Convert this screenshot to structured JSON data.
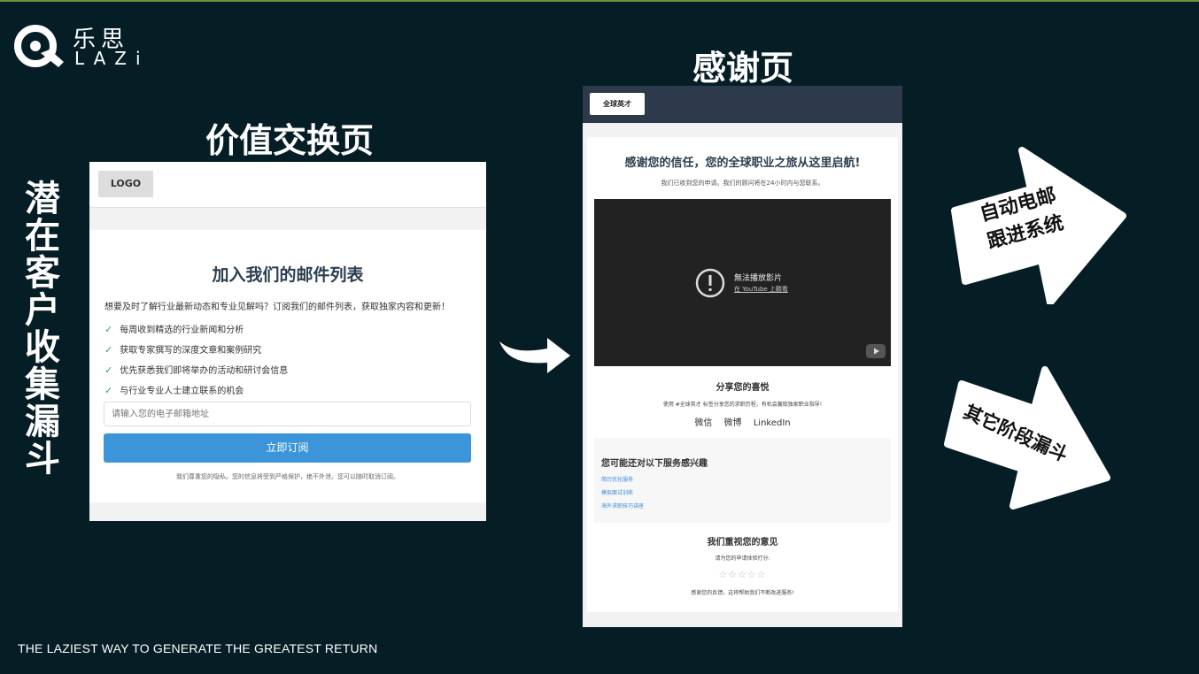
{
  "logo": {
    "cn": "乐思",
    "en": "LAZi"
  },
  "side_title": [
    "潜",
    "在",
    "客",
    "户",
    "收",
    "集",
    "漏",
    "斗"
  ],
  "value_page": {
    "section_title": "价值交换页",
    "logo_placeholder": "LOGO",
    "heading": "加入我们的邮件列表",
    "intro": "想要及时了解行业最新动态和专业见解吗？订阅我们的邮件列表，获取独家内容和更新！",
    "benefits": [
      "每周收到精选的行业新闻和分析",
      "获取专家撰写的深度文章和案例研究",
      "优先获悉我们即将举办的活动和研讨会信息",
      "与行业专业人士建立联系的机会"
    ],
    "email_placeholder": "请输入您的电子邮箱地址",
    "subscribe_label": "立即订阅",
    "privacy_note": "我们尊重您的隐私。您的信息将受到严格保护，绝不外泄。您可以随时取消订阅。"
  },
  "thank_you_page": {
    "section_title": "感谢页",
    "brand": "全球英才",
    "title": "感谢您的信任，您的全球职业之旅从这里启航!",
    "subtitle": "我们已收到您的申请。我们的顾问将在24小时内与您联系。",
    "video": {
      "error": "無法播放影片",
      "link": "在 YouTube 上觀看"
    },
    "share": {
      "heading": "分享您的喜悦",
      "desc": "使用 #全球英才 标签分享您的求职历程，有机会赢取独家职业指导!",
      "links": [
        "微信",
        "微博",
        "LinkedIn"
      ]
    },
    "services": {
      "heading": "您可能还对以下服务感兴趣",
      "items": [
        "简历优化服务",
        "模拟面试训练",
        "海外求职技巧讲座"
      ]
    },
    "feedback": {
      "heading": "我们重视您的意见",
      "desc": "请为您的申请体验打分:",
      "stars": "☆☆☆☆☆",
      "rating": 0,
      "thanks": "感谢您的反馈，这将帮助我们不断改进服务!"
    }
  },
  "arrows": {
    "email_followup": [
      "自动电邮",
      "跟进系统"
    ],
    "other_funnels": "其它阶段漏斗"
  },
  "footer": "THE LAZIEST WAY TO GENERATE THE GREATEST RETURN",
  "colors": {
    "background": "#051e26",
    "accent_blue": "#3b95d8",
    "check_green": "#27ae60"
  }
}
